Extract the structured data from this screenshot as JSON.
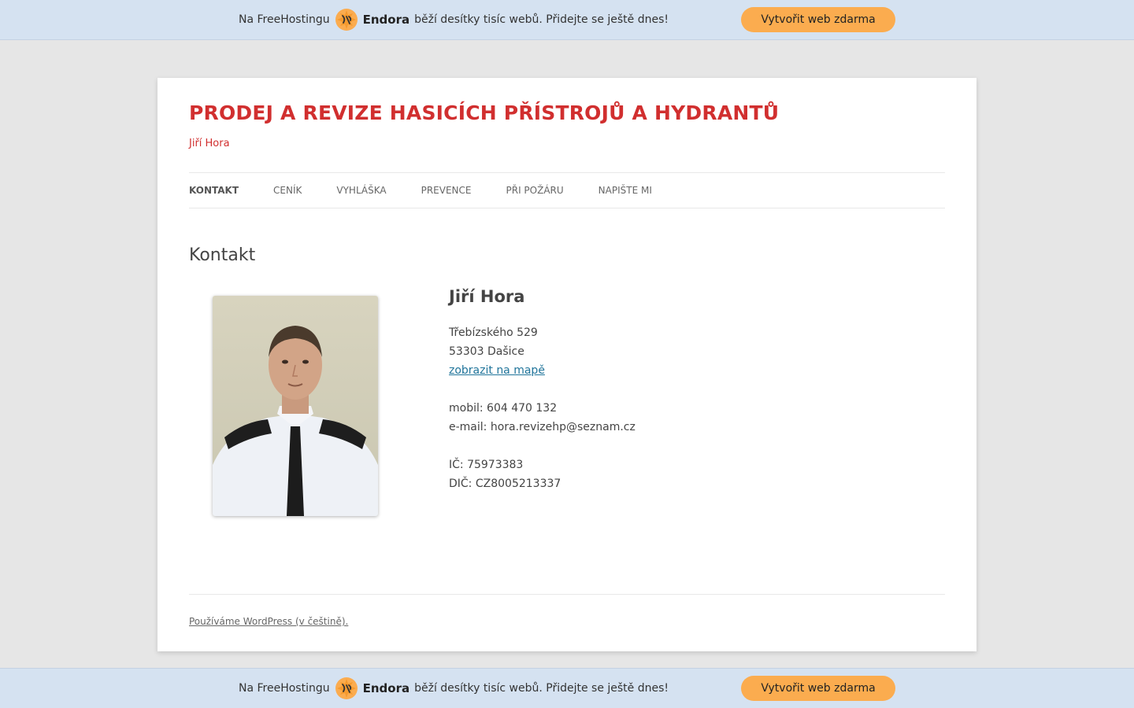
{
  "promo": {
    "prefix": "Na FreeHostingu",
    "brand": "Endora",
    "suffix": "běží desítky tisíc webů. Přidejte se ještě dnes!",
    "button_label": "Vytvořit web zdarma",
    "logo_icon": "endora-logo-icon",
    "accent_color": "#fbac4f"
  },
  "site": {
    "title": "PRODEJ A REVIZE HASICÍCH PŘÍSTROJŮ A HYDRANTŮ",
    "description": "Jiří Hora",
    "title_color": "#d12f2f"
  },
  "nav": {
    "items": [
      {
        "label": "KONTAKT",
        "active": true
      },
      {
        "label": "CENÍK"
      },
      {
        "label": "VYHLÁŠKA"
      },
      {
        "label": "PREVENCE"
      },
      {
        "label": "PŘI POŽÁRU"
      },
      {
        "label": "NAPIŠTE MI"
      }
    ]
  },
  "entry": {
    "title": "Kontakt",
    "name": "Jiří Hora",
    "street": "Třebízského 529",
    "city": "53303 Dašice",
    "map_link": "zobrazit na mapě",
    "mobile": "mobil: 604 470 132",
    "email": "e-mail: hora.revizehp@seznam.cz",
    "ic": "IČ: 75973383",
    "dic": "DIČ: CZ8005213337"
  },
  "footer": {
    "credit": "Používáme WordPress (v češtině)."
  }
}
